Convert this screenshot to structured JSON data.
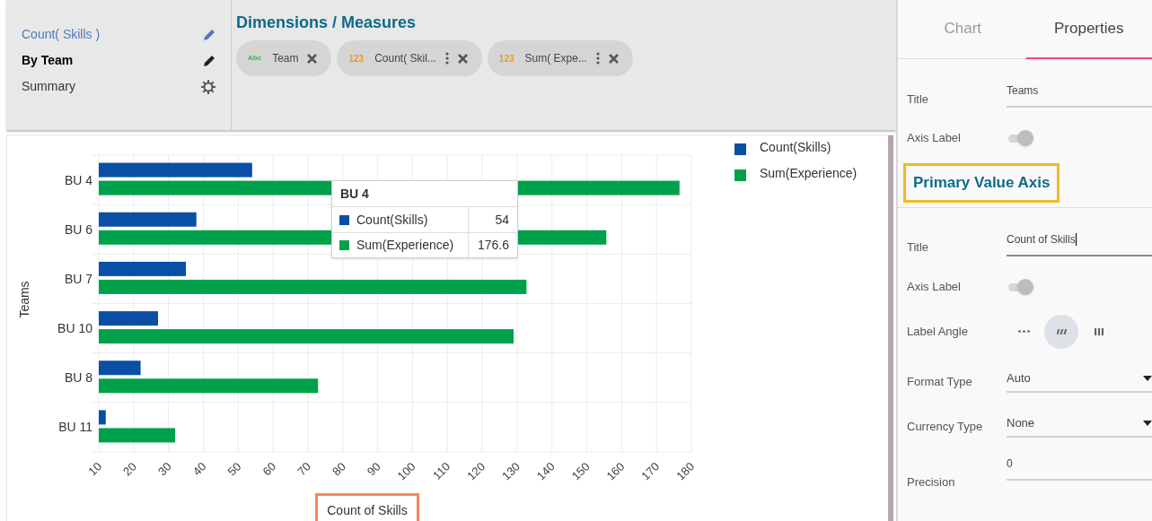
{
  "report_items": [
    {
      "label": "Count( Skills )",
      "kind": "measure"
    },
    {
      "label": "By Team",
      "kind": "heading"
    },
    {
      "label": "Summary",
      "kind": "plain"
    }
  ],
  "dimensions_measures": {
    "title": "Dimensions / Measures",
    "chips": [
      {
        "type_tag": "Abc",
        "label": "Team",
        "kind": "dimension",
        "has_menu": false
      },
      {
        "type_tag": "123",
        "label": "Count( Skil...",
        "kind": "measure",
        "has_menu": true
      },
      {
        "type_tag": "123",
        "label": "Sum( Expe...",
        "kind": "measure",
        "has_menu": true
      }
    ]
  },
  "chart": {
    "xlabel_highlighted": true,
    "chart_data": {
      "type": "bar",
      "orientation": "horizontal",
      "xlabel": "Count of Skills",
      "ylabel": "Teams",
      "categories": [
        "BU 4",
        "BU 6",
        "BU 7",
        "BU 10",
        "BU 8",
        "BU 11"
      ],
      "series": [
        {
          "name": "Count(Skills)",
          "color": "#0a4fa6",
          "values": [
            54,
            38,
            35,
            27,
            22,
            12
          ]
        },
        {
          "name": "Sum(Experience)",
          "color": "#00a14b",
          "values": [
            176.6,
            155.6,
            132.7,
            129,
            72.9,
            31.9
          ]
        }
      ],
      "grid": true,
      "legend": true,
      "xlim": [
        10,
        180
      ],
      "xticks": [
        10,
        20,
        30,
        40,
        50,
        60,
        70,
        80,
        90,
        100,
        110,
        120,
        130,
        140,
        150,
        160,
        170,
        180
      ]
    },
    "tooltip": {
      "title": "BU 4",
      "rows": [
        {
          "name": "Count(Skills)",
          "value": "54",
          "color": "#0a4fa6"
        },
        {
          "name": "Sum(Experience)",
          "value": "176.6",
          "color": "#00a14b"
        }
      ]
    }
  },
  "properties_panel": {
    "tabs": [
      {
        "label": "Chart",
        "selected": false
      },
      {
        "label": "Properties",
        "selected": true
      }
    ],
    "rows": [
      {
        "kind": "text_field",
        "label": "Title",
        "value": "Teams",
        "focused": false
      },
      {
        "kind": "toggle",
        "label": "Axis Label",
        "on": true
      },
      {
        "kind": "section_heading",
        "label": "Primary Value Axis",
        "highlighted": true
      },
      {
        "kind": "text_field",
        "label": "Title",
        "value": "Count of Skills",
        "focused": true
      },
      {
        "kind": "toggle",
        "label": "Axis Label",
        "on": true
      },
      {
        "kind": "angle_choice",
        "label": "Label Angle",
        "options": [
          {
            "selected": false
          },
          {
            "selected": true
          },
          {
            "selected": false
          }
        ]
      },
      {
        "kind": "dropdown",
        "label": "Format Type",
        "value": "Auto"
      },
      {
        "kind": "dropdown",
        "label": "Currency Type",
        "value": "None"
      },
      {
        "kind": "number_field",
        "label": "Precision",
        "value": "0"
      }
    ]
  }
}
